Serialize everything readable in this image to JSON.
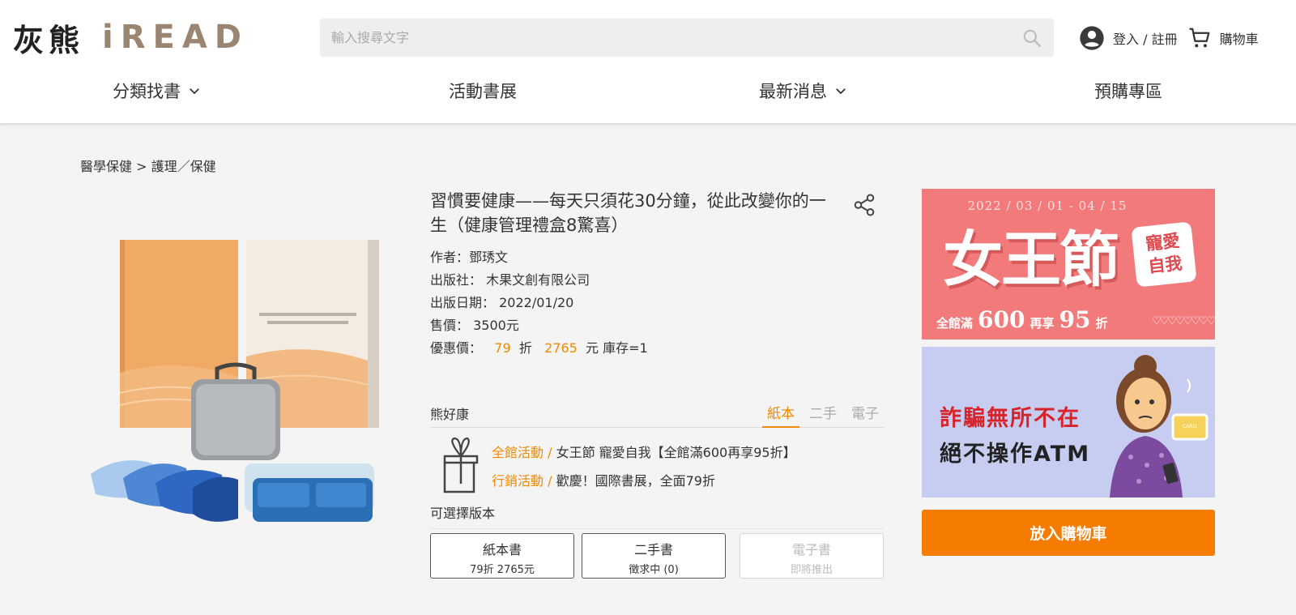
{
  "header": {
    "logo_cn": "灰熊",
    "logo_en": "iREAD",
    "search_placeholder": "輸入搜尋文字",
    "login_label": "登入 / 註冊",
    "cart_label": "購物車"
  },
  "nav": {
    "items": [
      {
        "label": "分類找書",
        "has_dropdown": true
      },
      {
        "label": "活動書展",
        "has_dropdown": false
      },
      {
        "label": "最新消息",
        "has_dropdown": true
      },
      {
        "label": "預購專區",
        "has_dropdown": false
      }
    ]
  },
  "breadcrumb": "醫學保健 > 護理／保健",
  "product": {
    "title": "習慣要健康——每天只須花30分鐘，從此改變你的一生（健康管理禮盒8驚喜）",
    "author_label": "作者：",
    "author": "鄧琇文",
    "publisher_label": "出版社：",
    "publisher": "木果文創有限公司",
    "date_label": "出版日期：",
    "date": "2022/01/20",
    "price_label": "售價：",
    "price": "3500元",
    "discount_label": "優惠價：",
    "discount_rate": "79",
    "discount_unit": "折",
    "discount_price": "2765",
    "stock_text": "元 庫存=1"
  },
  "store": {
    "name": "熊好康",
    "tabs": [
      {
        "label": "紙本",
        "active": true
      },
      {
        "label": "二手",
        "active": false
      },
      {
        "label": "電子",
        "active": false
      }
    ]
  },
  "promotions": [
    {
      "tag": "全館活動 /",
      "text": "女王節 寵愛自我【全館滿600再享95折】"
    },
    {
      "tag": "行銷活動 /",
      "text": "歡慶！國際書展，全面79折"
    }
  ],
  "versions": {
    "label": "可選擇版本",
    "items": [
      {
        "title": "紙本書",
        "sub": "79折 2765元",
        "enabled": true
      },
      {
        "title": "二手書",
        "sub": "徵求中 (0)",
        "enabled": true
      },
      {
        "title": "電子書",
        "sub": "即將推出",
        "enabled": false
      }
    ]
  },
  "banner1": {
    "date": "2022 / 03 / 01 - 04 / 15",
    "headline": "女王節",
    "badge_line1": "寵愛",
    "badge_line2": "自我",
    "prefix": "全館滿",
    "amount": "600",
    "middle": "再享",
    "rate": "95",
    "suffix": "折"
  },
  "banner2": {
    "line1": "詐騙無所不在",
    "line2": "絕不操作ATM",
    "card_text": "CARD"
  },
  "add_to_cart": "放入購物車",
  "colors": {
    "accent": "#f57c00",
    "price_orange": "#f08a00",
    "banner1_bg": "#f27a7b",
    "banner2_bg": "#c6cdf0"
  }
}
